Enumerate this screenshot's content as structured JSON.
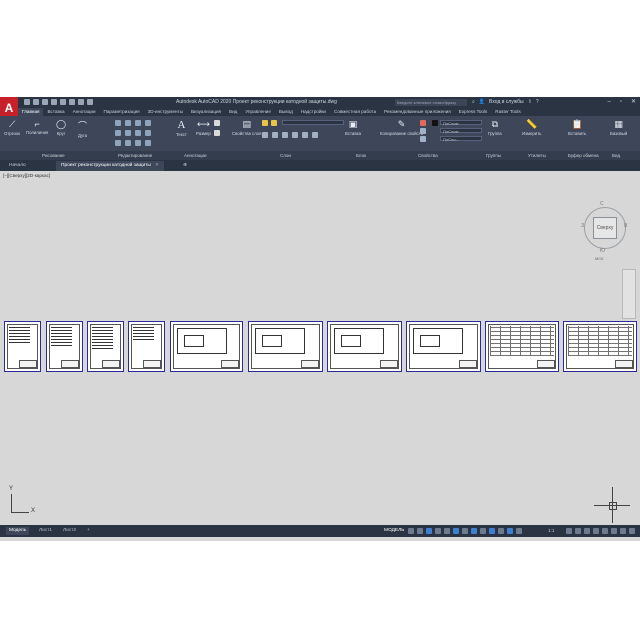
{
  "app": {
    "title": "Autodesk AutoCAD 2020   Проект реконструкции катодной защиты.dwg",
    "search_placeholder": "Введите ключевое слово/фразу",
    "sign_in": "Вход в службы",
    "logo_letter": "A"
  },
  "ribbon_tabs": [
    "Главная",
    "Вставка",
    "Аннотации",
    "Параметризация",
    "3D-инструменты",
    "Визуализация",
    "Вид",
    "Управление",
    "Вывод",
    "Надстройки",
    "Совместная работа",
    "Рекомендованные приложения",
    "Express Tools",
    "Raster Tools"
  ],
  "tools": {
    "line": "Отрезок",
    "polyline": "Полилиния",
    "circle": "Круг",
    "arc": "Дуга",
    "text": "Текст",
    "dimension": "Размер",
    "layer_props": "Свойства слоя",
    "insert": "Вставка",
    "match_props": "Копирование свойств",
    "group": "Группа",
    "measure": "Измерить",
    "paste": "Вставить",
    "base": "Базовый"
  },
  "layer_combos": [
    "ПоСлою",
    "ПоСлою",
    "ПоСло..."
  ],
  "panels": [
    "Рисование",
    "Редактирование",
    "Аннотации",
    "Слои",
    "Блок",
    "Свойства",
    "Группы",
    "Утилиты",
    "Буфер обмена",
    "Вид"
  ],
  "file_tabs": {
    "start": "Начало",
    "active": "Проект реконструкции катодной защиты"
  },
  "canvas": {
    "view_label": "[–][Сверху][2D-каркас]"
  },
  "viewcube": {
    "face": "Сверху",
    "n": "С",
    "s": "Ю",
    "w": "З",
    "e": "В",
    "ucs": "МСК"
  },
  "ucs_axes": {
    "x": "X",
    "y": "Y"
  },
  "layout_tabs": [
    "Модель",
    "Лист1",
    "Лист2",
    "+"
  ],
  "status": {
    "model": "МОДЕЛЬ",
    "scale": "1:1"
  }
}
